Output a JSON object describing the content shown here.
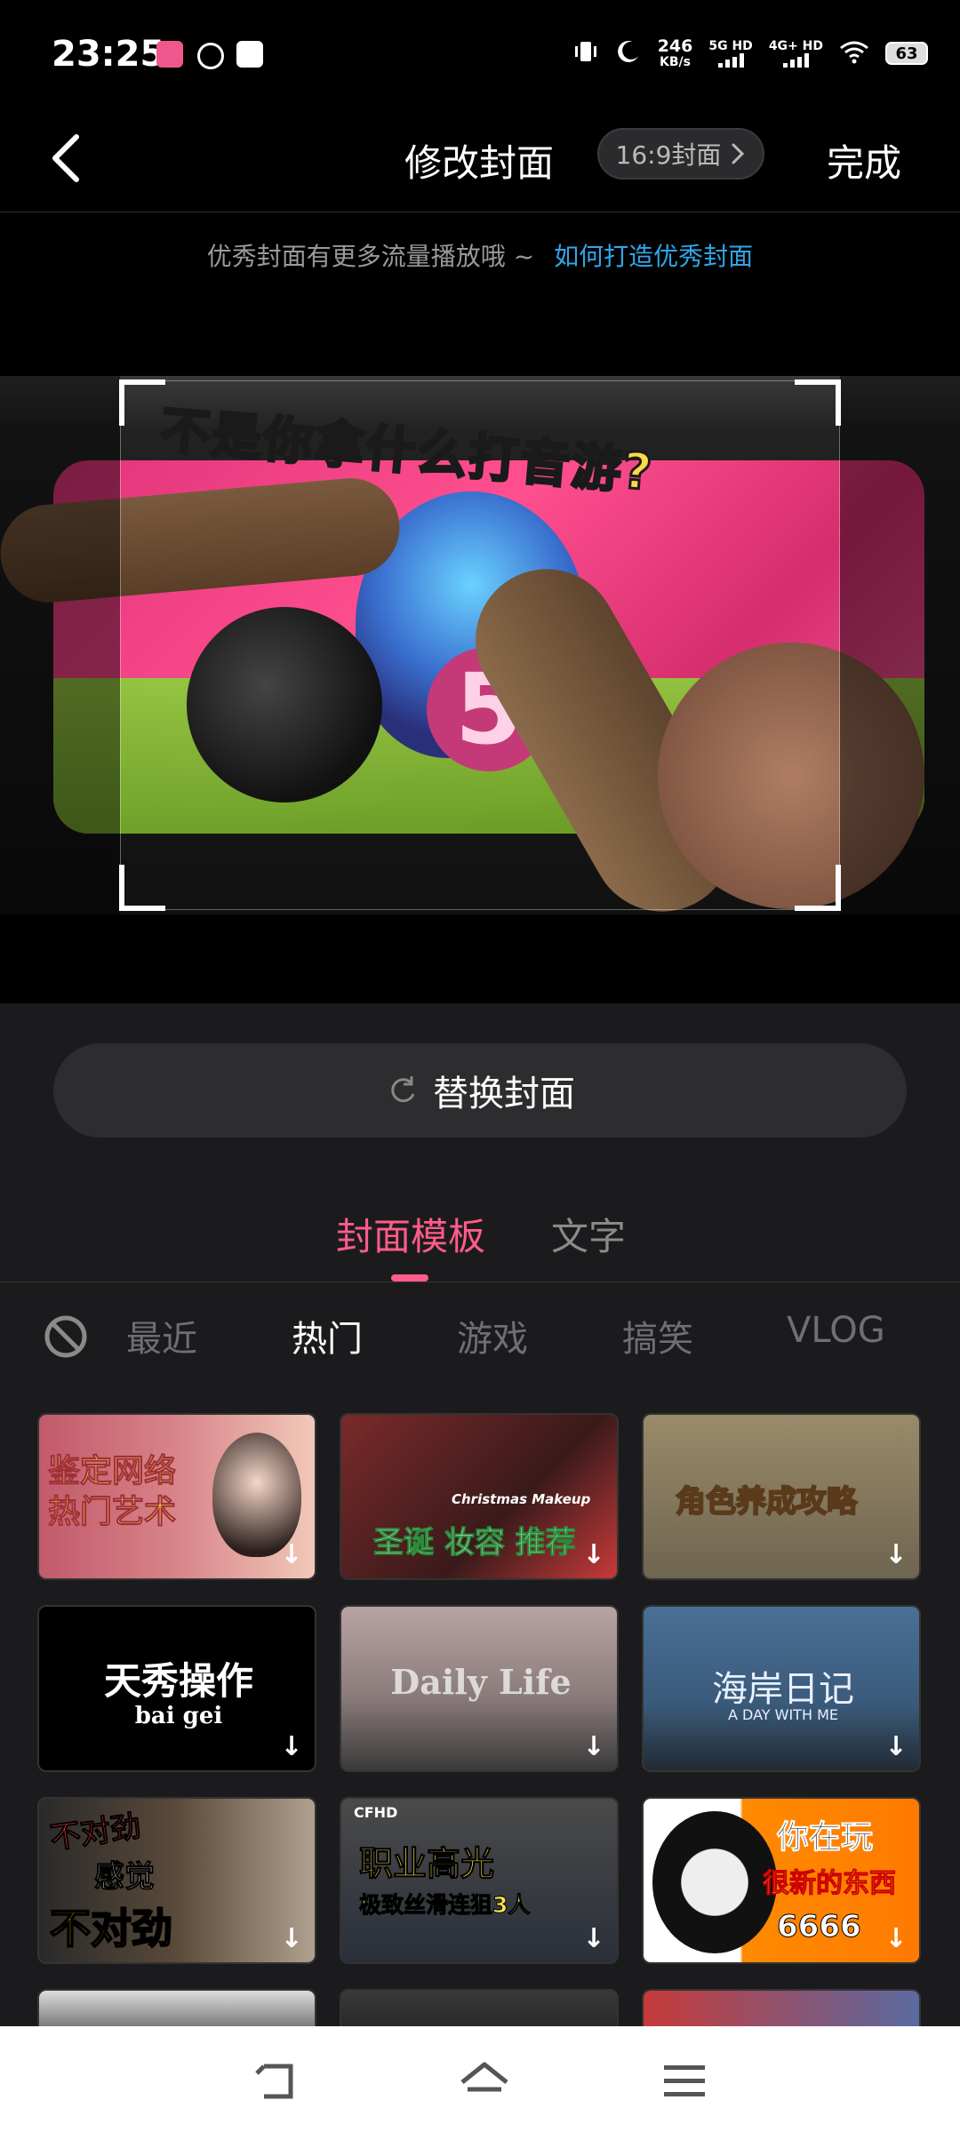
{
  "status_bar": {
    "time": "23:25",
    "net_speed_value": "246",
    "net_speed_unit": "KB/s",
    "sim1": "5G HD",
    "sim2": "4G+ HD",
    "battery": "63"
  },
  "header": {
    "title": "修改封面",
    "ratio_label": "16:9封面",
    "done_label": "完成"
  },
  "hint": {
    "text": "优秀封面有更多流量播放哦 ~",
    "link": "如何打造优秀封面"
  },
  "cover": {
    "overlay_text": "不是你拿什么打音游?",
    "big_number": "5"
  },
  "replace_button": {
    "label": "替换封面"
  },
  "tabs": [
    {
      "label": "封面模板",
      "active": true
    },
    {
      "label": "文字",
      "active": false
    }
  ],
  "categories": [
    "最近",
    "热门",
    "游戏",
    "搞笑",
    "VLOG"
  ],
  "templates": [
    {
      "lines": [
        "鉴定网络",
        "热门艺术"
      ]
    },
    {
      "lines": [
        "圣诞 妆容 推荐"
      ],
      "sub": "Christmas Makeup"
    },
    {
      "lines": [
        "角色养成攻略"
      ]
    },
    {
      "lines": [
        "天秀操作"
      ],
      "sub": "bai gei"
    },
    {
      "lines": [
        "Daily Life"
      ]
    },
    {
      "lines": [
        "海岸日记"
      ],
      "sub": "A DAY WITH ME"
    },
    {
      "lines": [
        "不对劲",
        "感觉",
        "不对劲"
      ]
    },
    {
      "lines": [
        "职业高光",
        "极致丝滑连狙3人"
      ],
      "badge": "CFHD"
    },
    {
      "lines": [
        "你在玩",
        "很新的东西",
        "6666"
      ]
    }
  ],
  "colors": {
    "accent": "#ff5c8a",
    "link": "#2fa6e8",
    "background": "#1b1b1d"
  }
}
